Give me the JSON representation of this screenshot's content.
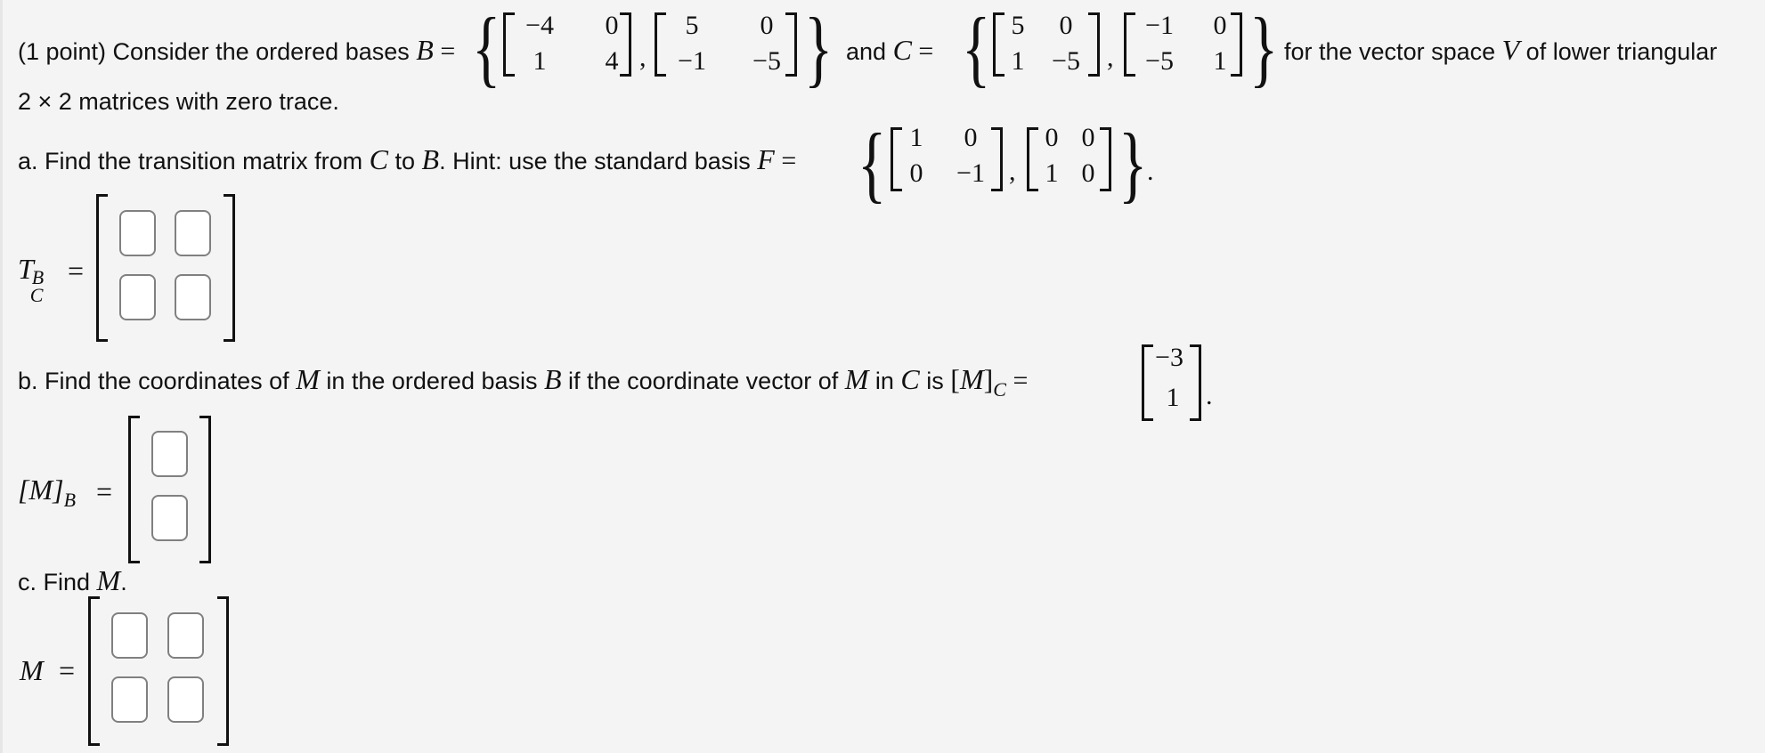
{
  "problem": {
    "line1": {
      "prefix": "(1 point) Consider the ordered bases ",
      "basis_b_symbol": "B",
      "equals": "=",
      "and_text": "and ",
      "basis_c_symbol": "C",
      "suffix_before_v": "for the vector space ",
      "v_symbol": "V",
      "suffix_after_v": " of lower triangular"
    },
    "line2": "2 × 2 matrices with zero trace.",
    "basis_B": [
      {
        "a": "−4",
        "b": "0",
        "c": "1",
        "d": "4"
      },
      {
        "a": "5",
        "b": "0",
        "c": "−1",
        "d": "−5"
      }
    ],
    "basis_C": [
      {
        "a": "5",
        "b": "0",
        "c": "1",
        "d": "−5"
      },
      {
        "a": "−1",
        "b": "0",
        "c": "−5",
        "d": "1"
      }
    ],
    "part_a": {
      "prefix": "a. Find the transition matrix from ",
      "from_symbol": "C",
      "to_text": " to ",
      "to_symbol": "B",
      "hint": ". Hint: use the standard basis ",
      "f_symbol": "F",
      "equals": "=",
      "basis_F": [
        {
          "a": "1",
          "b": "0",
          "c": "0",
          "d": "−1"
        },
        {
          "a": "0",
          "b": "0",
          "c": "1",
          "d": "0"
        }
      ],
      "period": ".",
      "answer_label_main": "T",
      "answer_label_sup": "B",
      "answer_label_sub": "C",
      "answer_equals": "=",
      "answers": [
        "",
        "",
        "",
        ""
      ]
    },
    "part_b": {
      "prefix": "b. Find the coordinates of ",
      "m_symbol": "M",
      "mid": " in the ordered basis ",
      "b_symbol": "B",
      "mid2": " if the coordinate vector of ",
      "mid3": " in ",
      "c_symbol": "C",
      "is_text": " is ",
      "lhs_open": "[",
      "lhs_close": "]",
      "lhs_sub": "C",
      "equals": "=",
      "vector_C": [
        "−3",
        "1"
      ],
      "period": ".",
      "answer_label_main": "[M]",
      "answer_label_sub": "B",
      "answer_equals": "=",
      "answers": [
        "",
        ""
      ]
    },
    "part_c": {
      "prefix": "c. Find ",
      "m_symbol": "M",
      "period": ".",
      "answer_label": "M",
      "answer_equals": "=",
      "answers": [
        "",
        "",
        "",
        ""
      ]
    }
  }
}
